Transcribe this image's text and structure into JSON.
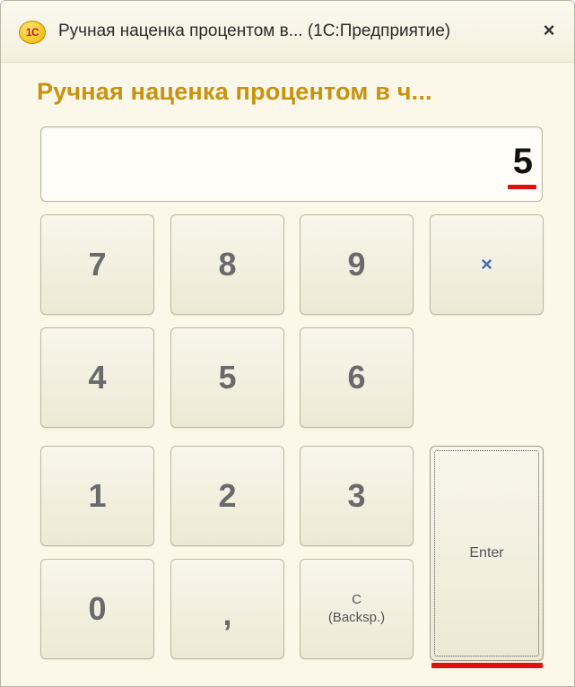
{
  "window": {
    "app_icon": "1C",
    "title": "Ручная наценка процентом в...  (1С:Предприятие)",
    "close_icon": "×"
  },
  "form": {
    "header": "Ручная наценка процентом в ч..."
  },
  "display": {
    "value": "5"
  },
  "keypad": {
    "k7": "7",
    "k8": "8",
    "k9": "9",
    "clear_icon": "×",
    "k4": "4",
    "k5": "5",
    "k6": "6",
    "k1": "1",
    "k2": "2",
    "k3": "3",
    "k0": "0",
    "comma": ",",
    "backspace_line1": "C",
    "backspace_line2": "(Backsp.)",
    "enter": "Enter"
  },
  "colors": {
    "header": "#c9920e",
    "highlight_underline": "#e01010",
    "clear_icon": "#3c6fb6",
    "window_bg": "#fbf8e9"
  }
}
